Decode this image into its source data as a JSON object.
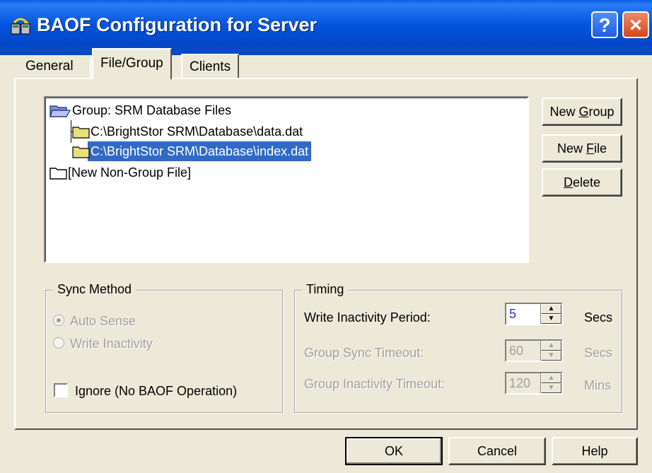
{
  "window": {
    "title": "BAOF Configuration for Server",
    "help_glyph": "?",
    "close_glyph": "×"
  },
  "tabs": [
    {
      "label": "General",
      "selected": false
    },
    {
      "label": "File/Group",
      "selected": true
    },
    {
      "label": "Clients",
      "selected": false
    }
  ],
  "tree": {
    "items": [
      {
        "label": "Group: SRM Database Files",
        "icon": "open-folder-icon",
        "level": 0,
        "selected": false
      },
      {
        "label": "C:\\BrightStor SRM\\Database\\data.dat",
        "icon": "file-folder-icon",
        "level": 1,
        "selected": false
      },
      {
        "label": "C:\\BrightStor SRM\\Database\\index.dat",
        "icon": "file-folder-icon",
        "level": 1,
        "selected": true
      },
      {
        "label": "[New Non-Group File]",
        "icon": "empty-folder-icon",
        "level": 0,
        "selected": false
      }
    ]
  },
  "side_buttons": {
    "new_group_prefix": "New ",
    "new_group_mnemonic": "G",
    "new_group_suffix": "roup",
    "new_file_prefix": "New ",
    "new_file_mnemonic": "F",
    "new_file_suffix": "ile",
    "delete_mnemonic": "D",
    "delete_suffix": "elete"
  },
  "sync_method": {
    "title": "Sync Method",
    "options": [
      {
        "label": "Auto Sense",
        "checked": true,
        "enabled": false
      },
      {
        "label": "Write Inactivity",
        "checked": false,
        "enabled": false
      }
    ],
    "ignore_label": "Ignore (No BAOF Operation)",
    "ignore_checked": false
  },
  "timing": {
    "title": "Timing",
    "rows": [
      {
        "label": "Write Inactivity Period:",
        "value": "5",
        "unit": "Secs",
        "enabled": true
      },
      {
        "label": "Group Sync Timeout:",
        "value": "60",
        "unit": "Secs",
        "enabled": false
      },
      {
        "label": "Group Inactivity Timeout:",
        "value": "120",
        "unit": "Mins",
        "enabled": false
      }
    ]
  },
  "footer": {
    "ok": "OK",
    "cancel": "Cancel",
    "help": "Help"
  },
  "colors": {
    "titlebar": "#0453dd",
    "selection": "#316ac5",
    "face": "#ece9d8",
    "folder": "#e8e07a"
  }
}
